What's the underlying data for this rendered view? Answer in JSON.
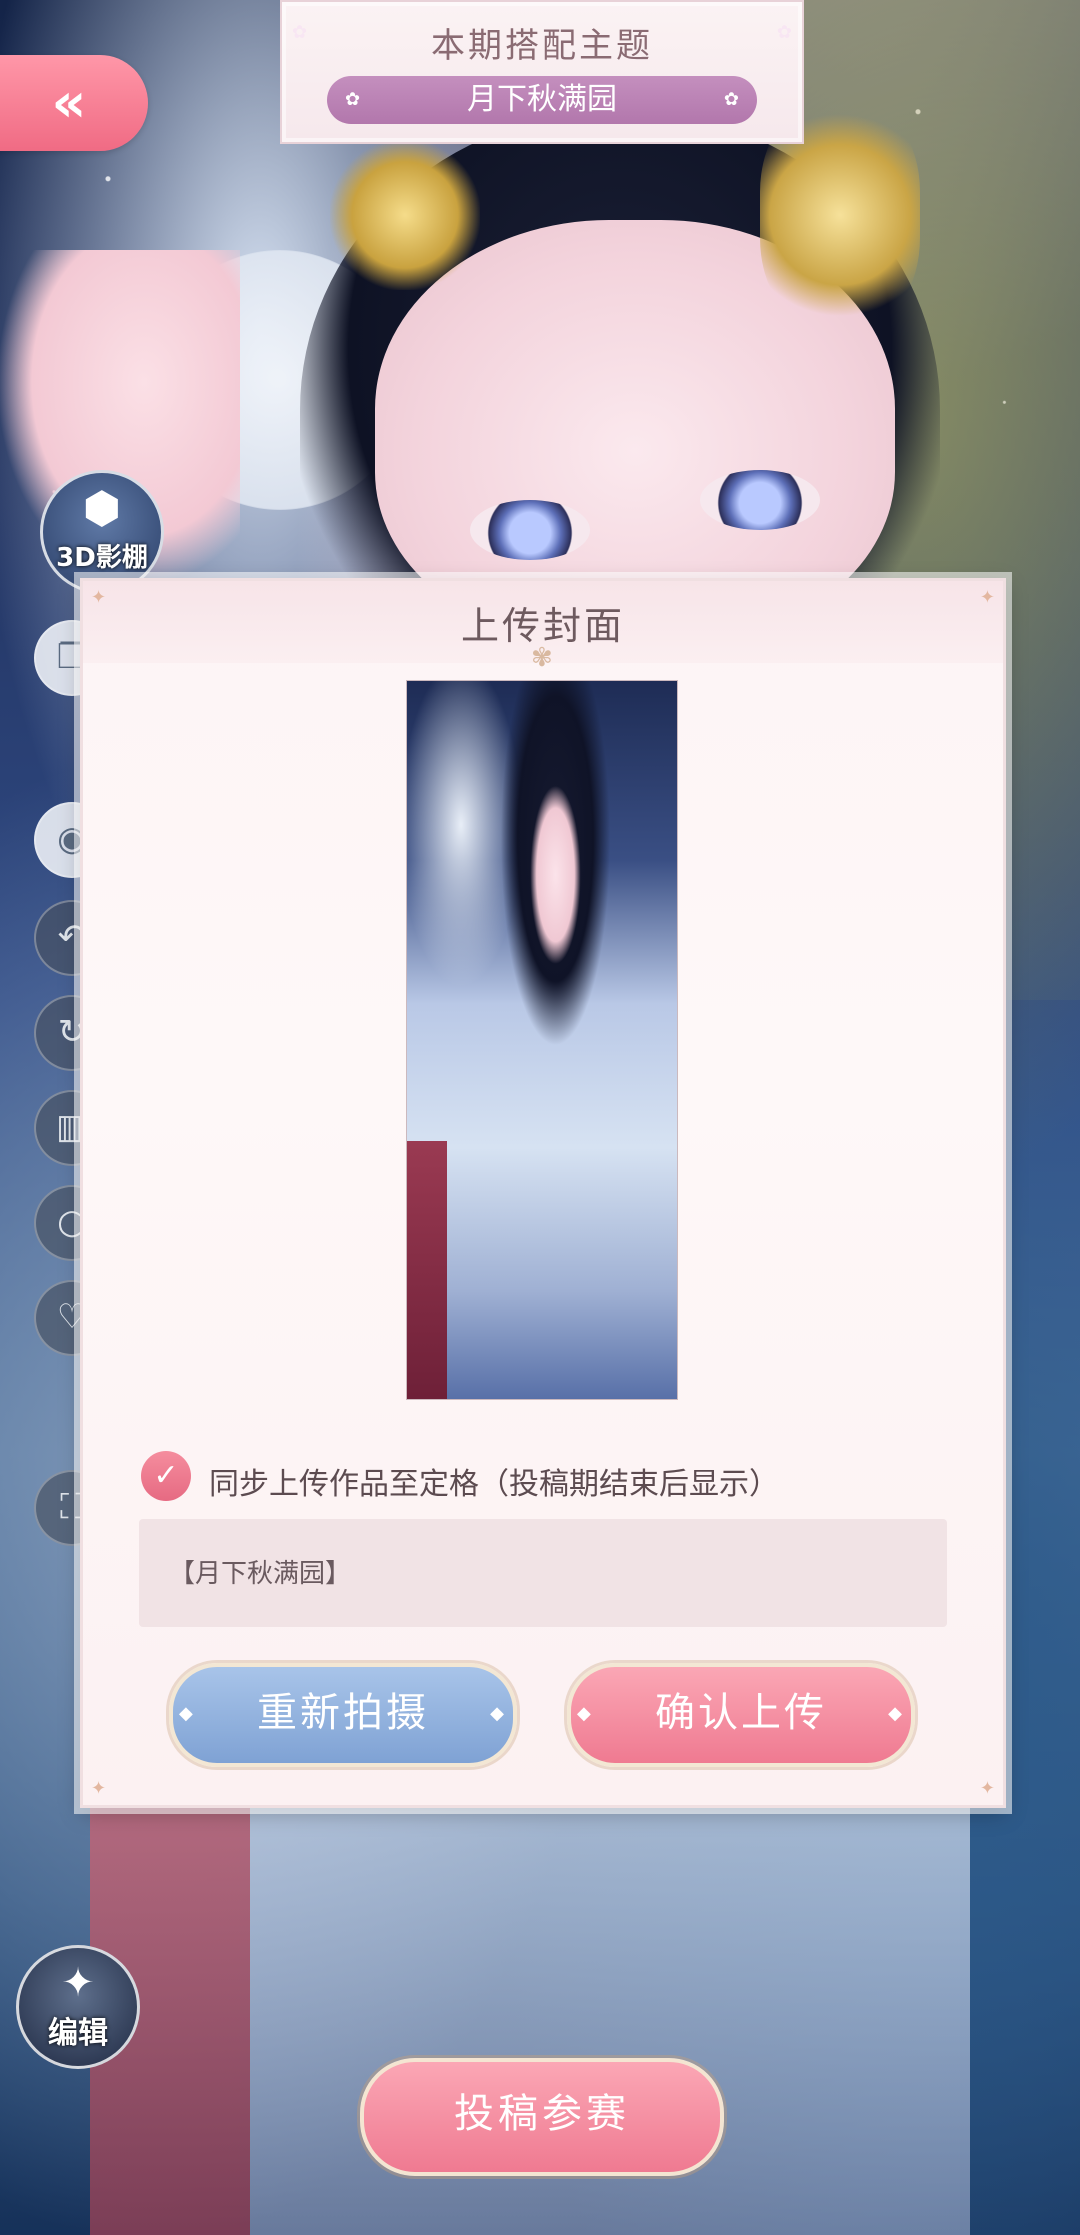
{
  "theme": {
    "title": "本期搭配主题",
    "name": "月下秋满园"
  },
  "nav": {
    "back_glyph": "«"
  },
  "left_rail": {
    "studio_label": "3D影棚",
    "edit_label": "编辑",
    "icons": [
      "cube-icon",
      "layers-icon",
      "eye-icon",
      "undo-icon",
      "redo-icon",
      "delete-icon",
      "reset-icon",
      "heart-icon",
      "frame-icon"
    ]
  },
  "modal": {
    "title": "上传封面",
    "sync_checkbox_label": "同步上传作品至定格（投稿期结束后显示）",
    "sync_checked": true,
    "name_value": "【月下秋满园】",
    "retake_label": "重新拍摄",
    "confirm_label": "确认上传"
  },
  "bottom": {
    "submit_label": "投稿参赛"
  },
  "colors": {
    "pink_button": "#f07a91",
    "blue_button": "#7fa2d4",
    "theme_pill": "#b277ac"
  }
}
